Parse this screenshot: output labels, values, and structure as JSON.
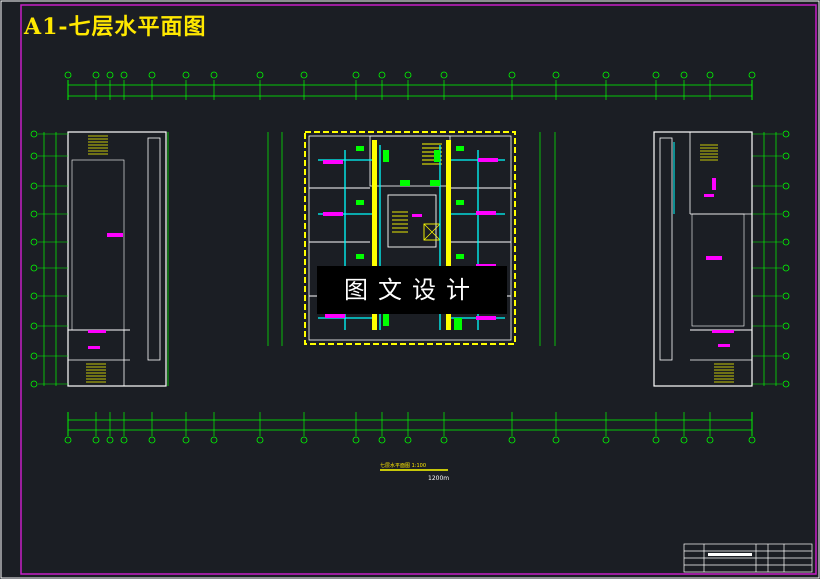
{
  "title": "A1-七层水平面图",
  "watermark": "图文设计",
  "scale_label": "七层水平面图  1:100",
  "scale_value": "1200m",
  "colors": {
    "background": "#1b1e24",
    "frame": "#c71fc7",
    "grid": "#00ff00",
    "walls": "#ffffff",
    "ducts": "#ffff00",
    "pipes": "#00ffff",
    "tags": "#ff00ff",
    "title_text": "#ffe800"
  }
}
